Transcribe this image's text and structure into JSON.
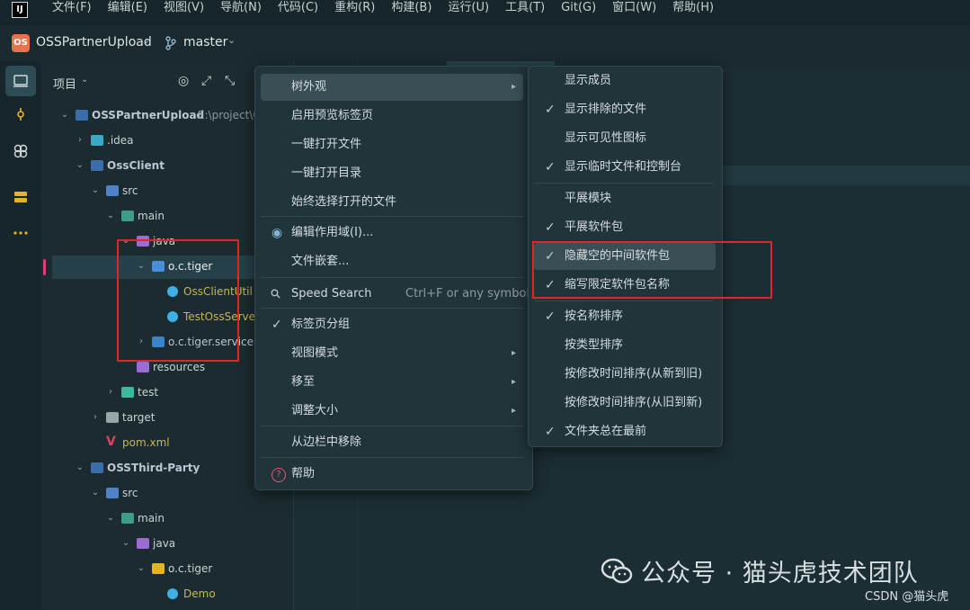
{
  "menubar": {
    "app_icon_text": "IJ",
    "items": [
      "文件(F)",
      "编辑(E)",
      "视图(V)",
      "导航(N)",
      "代码(C)",
      "重构(R)",
      "构建(B)",
      "运行(U)",
      "工具(T)",
      "Git(G)",
      "窗口(W)",
      "帮助(H)"
    ]
  },
  "titlebar": {
    "project_badge": "OS",
    "project_name": "OSSPartnerUpload",
    "branch": "master"
  },
  "project_panel": {
    "title": "项目",
    "tree": [
      {
        "label": "OSSPartnerUpload",
        "suffix": "E:\\project\\OS",
        "depth": 0,
        "arrow": "open",
        "icon": "module"
      },
      {
        "label": ".idea",
        "depth": 1,
        "arrow": "closed",
        "icon": "folder-config"
      },
      {
        "label": "OssClient",
        "depth": 1,
        "arrow": "open",
        "icon": "module"
      },
      {
        "label": "src",
        "depth": 2,
        "arrow": "open",
        "icon": "folder-src"
      },
      {
        "label": "main",
        "depth": 3,
        "arrow": "open",
        "icon": "folder-main"
      },
      {
        "label": "java",
        "depth": 4,
        "arrow": "open",
        "icon": "folder-java"
      },
      {
        "label": "o.c.tiger",
        "depth": 5,
        "arrow": "open",
        "icon": "package"
      },
      {
        "label": "OssClientUtil",
        "depth": 6,
        "arrow": "none",
        "icon": "class"
      },
      {
        "label": "TestOssServerUti",
        "depth": 6,
        "arrow": "none",
        "icon": "class"
      },
      {
        "label": "o.c.tiger.service",
        "depth": 5,
        "arrow": "closed",
        "icon": "package-service"
      },
      {
        "label": "resources",
        "depth": 4,
        "arrow": "none",
        "icon": "folder-res"
      },
      {
        "label": "test",
        "depth": 3,
        "arrow": "closed",
        "icon": "folder-test"
      },
      {
        "label": "target",
        "depth": 2,
        "arrow": "closed",
        "icon": "folder-target"
      },
      {
        "label": "pom.xml",
        "depth": 2,
        "arrow": "none",
        "icon": "maven"
      },
      {
        "label": "OSSThird-Party",
        "depth": 1,
        "arrow": "open",
        "icon": "module"
      },
      {
        "label": "src",
        "depth": 2,
        "arrow": "open",
        "icon": "folder-src"
      },
      {
        "label": "main",
        "depth": 3,
        "arrow": "open",
        "icon": "folder-main"
      },
      {
        "label": "java",
        "depth": 4,
        "arrow": "open",
        "icon": "folder-java"
      },
      {
        "label": "o.c.tiger",
        "depth": 5,
        "arrow": "open",
        "icon": "package-folder"
      },
      {
        "label": "Demo",
        "depth": 6,
        "arrow": "none",
        "icon": "class"
      }
    ]
  },
  "context_menu": {
    "items": [
      {
        "label": "树外观",
        "submenu": true,
        "hover": true
      },
      {
        "label": "启用预览标签页"
      },
      {
        "label": "一键打开文件"
      },
      {
        "label": "一键打开目录"
      },
      {
        "label": "始终选择打开的文件"
      },
      {
        "label": "编辑作用域(I)...",
        "icon": "scope-icon"
      },
      {
        "label": "文件嵌套..."
      },
      {
        "label": "Speed Search",
        "icon": "search-icon",
        "shortcut": "Ctrl+F or any symbol"
      },
      {
        "label": "标签页分组",
        "checked": true
      },
      {
        "label": "视图模式",
        "submenu": true
      },
      {
        "label": "移至",
        "submenu": true
      },
      {
        "label": "调整大小",
        "submenu": true
      },
      {
        "label": "从边栏中移除"
      },
      {
        "label": "帮助",
        "icon": "help-icon"
      }
    ]
  },
  "submenu": {
    "items": [
      {
        "label": "显示成员",
        "checked": false
      },
      {
        "label": "显示排除的文件",
        "checked": true
      },
      {
        "label": "显示可见性图标",
        "checked": false
      },
      {
        "label": "显示临时文件和控制台",
        "checked": true
      },
      {
        "label": "平展模块",
        "checked": false
      },
      {
        "label": "平展软件包",
        "checked": true
      },
      {
        "label": "隐藏空的中间软件包",
        "checked": true,
        "hover": true
      },
      {
        "label": "缩写限定软件包名称",
        "checked": true
      },
      {
        "label": "按名称排序",
        "checked": true
      },
      {
        "label": "按类型排序",
        "checked": false
      },
      {
        "label": "按修改时间排序(从新到旧)",
        "checked": false
      },
      {
        "label": "按修改时间排序(从旧到新)",
        "checked": false
      },
      {
        "label": "文件夹总在最前",
        "checked": true
      }
    ]
  },
  "watermark": {
    "text": "公众号 · 猫头虎技术团队",
    "csdn": "CSDN @猫头虎"
  },
  "colors": {
    "accent_red_box": "#e0262b",
    "class_label": "#c7b84a",
    "selection_marker": "#d4447a"
  }
}
